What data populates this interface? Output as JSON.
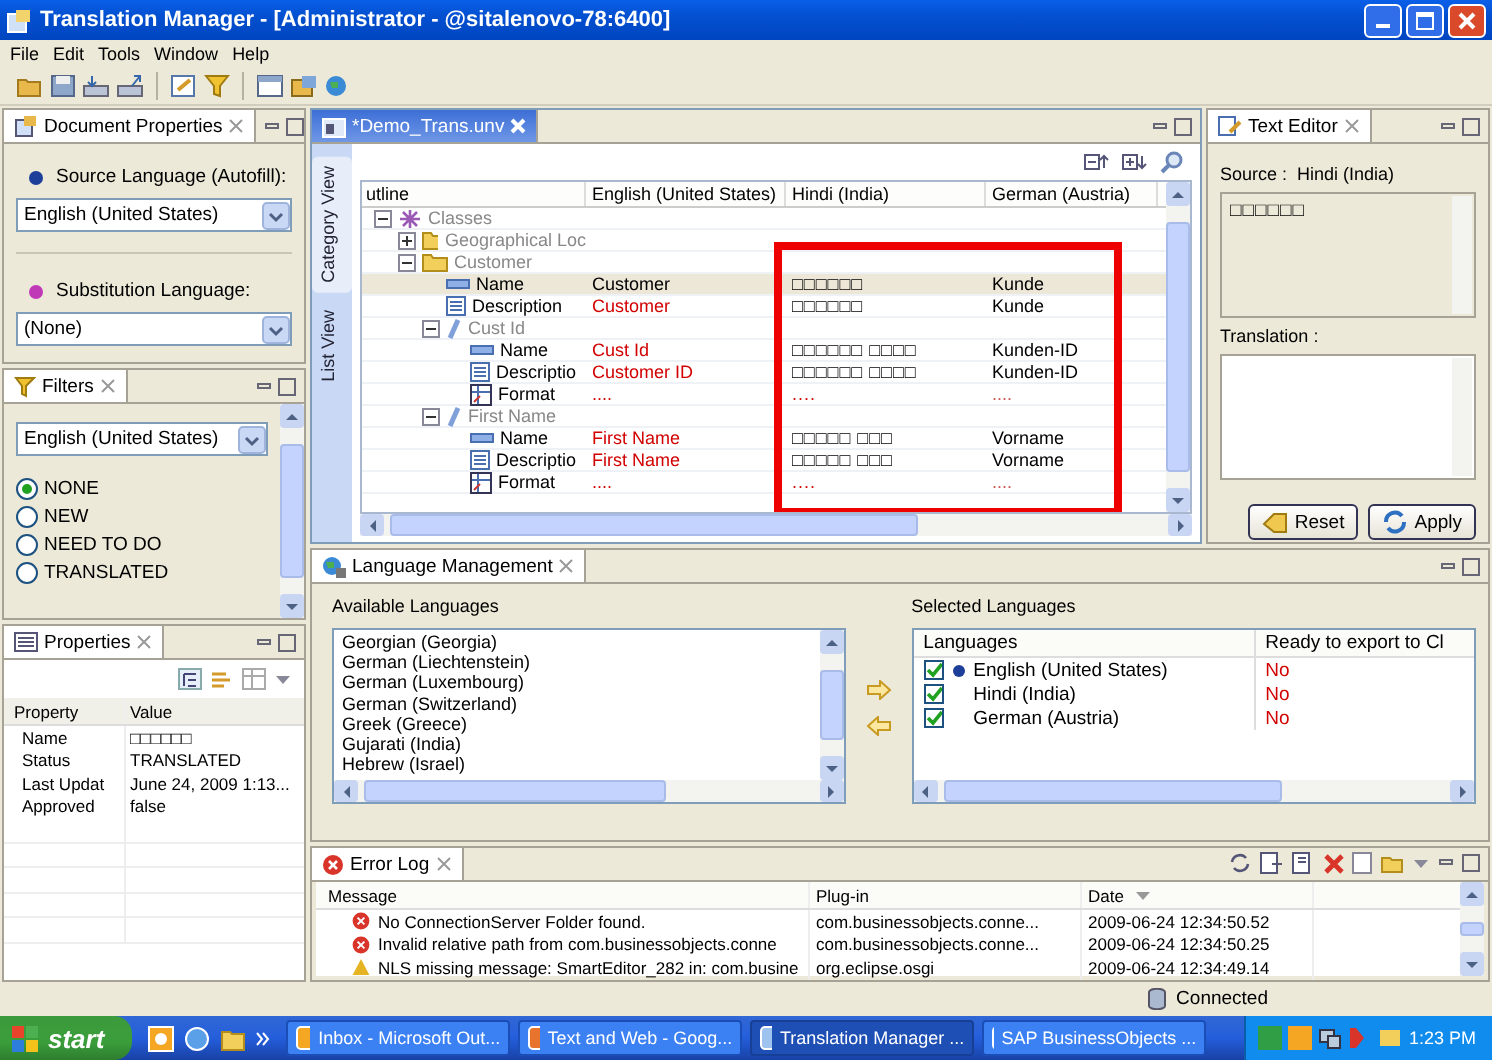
{
  "window": {
    "title": "Translation Manager - [Administrator - @sitalenovo-78:6400]"
  },
  "menu": [
    "File",
    "Edit",
    "Tools",
    "Window",
    "Help"
  ],
  "document_properties": {
    "tab": "Document Properties",
    "source_label": "Source Language (Autofill):",
    "source_value": "English (United States)",
    "substitution_label": "Substitution Language:",
    "substitution_value": "(None)"
  },
  "filters": {
    "tab": "Filters",
    "language": "English (United States)",
    "options": [
      {
        "label": "NONE",
        "selected": true
      },
      {
        "label": "NEW",
        "selected": false
      },
      {
        "label": "NEED TO DO",
        "selected": false
      },
      {
        "label": "TRANSLATED",
        "selected": false
      }
    ]
  },
  "properties": {
    "tab": "Properties",
    "columns": [
      "Property",
      "Value"
    ],
    "rows": [
      [
        "Name",
        "□□□□□□"
      ],
      [
        "Status",
        "TRANSLATED"
      ],
      [
        "Last Updat",
        "June 24, 2009 1:13..."
      ],
      [
        "Approved",
        "false"
      ]
    ]
  },
  "editor": {
    "tab": "*Demo_Trans.unv",
    "side_tabs": [
      {
        "label": "Category View",
        "selected": true
      },
      {
        "label": "List View",
        "selected": false
      }
    ],
    "columns": [
      "utline",
      "English (United States)",
      "Hindi (India)",
      "German (Austria)"
    ],
    "rows": [
      {
        "kind": "classes",
        "label": "Classes",
        "expanded": true,
        "selected": false,
        "children": [
          {
            "kind": "folder",
            "label": "Geographical Loc",
            "expanded": false,
            "selected": false
          },
          {
            "kind": "folder",
            "label": "Customer",
            "expanded": true,
            "selected": false,
            "children": [
              {
                "kind": "name",
                "label": "Name",
                "selected": true,
                "english": "Customer",
                "hindi": "□□□□□□",
                "german": "Kunde",
                "flagged": false
              },
              {
                "kind": "description",
                "label": "Description",
                "selected": false,
                "english": "Customer",
                "hindi": "□□□□□□",
                "german": "Kunde",
                "flagged": true
              },
              {
                "kind": "object",
                "label": "Cust Id",
                "expanded": true,
                "selected": false,
                "children": [
                  {
                    "kind": "name",
                    "label": "Name",
                    "selected": false,
                    "english": "Cust Id",
                    "hindi": "□□□□□□ □□□□",
                    "german": "Kunden-ID",
                    "flagged": true
                  },
                  {
                    "kind": "description",
                    "label": "Descriptio",
                    "selected": false,
                    "english": "Customer ID",
                    "hindi": "□□□□□□ □□□□",
                    "german": "Kunden-ID",
                    "flagged": true
                  },
                  {
                    "kind": "format",
                    "label": "Format",
                    "selected": false,
                    "english": "....",
                    "hindi": "....",
                    "german": "....",
                    "flagged": true
                  }
                ]
              },
              {
                "kind": "object",
                "label": "First Name",
                "expanded": true,
                "selected": false,
                "children": [
                  {
                    "kind": "name",
                    "label": "Name",
                    "selected": false,
                    "english": "First Name",
                    "hindi": "□□□□□ □□□",
                    "german": "Vorname",
                    "flagged": true
                  },
                  {
                    "kind": "description",
                    "label": "Descriptio",
                    "selected": false,
                    "english": "First Name",
                    "hindi": "□□□□□ □□□",
                    "german": "Vorname",
                    "flagged": true
                  },
                  {
                    "kind": "format",
                    "label": "Format",
                    "selected": false,
                    "english": "....",
                    "hindi": "....",
                    "german": "....",
                    "flagged": true
                  }
                ]
              }
            ]
          }
        ]
      }
    ]
  },
  "text_editor": {
    "tab": "Text Editor",
    "source_label": "Source :  Hindi (India)",
    "source_text": "□□□□□□",
    "translation_label": "Translation :",
    "buttons": [
      "Reset",
      "Apply"
    ]
  },
  "language_management": {
    "tab": "Language Management",
    "available_label": "Available Languages",
    "available": [
      "Georgian (Georgia)",
      "German (Liechtenstein)",
      "German (Luxembourg)",
      "German (Switzerland)",
      "Greek (Greece)",
      "Gujarati (India)",
      "Hebrew (Israel)"
    ],
    "selected_label": "Selected Languages",
    "columns": [
      "Languages",
      "Ready to export to Cl"
    ],
    "selected": [
      {
        "name": "English (United States)",
        "checked": true,
        "source": true,
        "ready": "No"
      },
      {
        "name": "Hindi (India)",
        "checked": true,
        "source": false,
        "ready": "No"
      },
      {
        "name": "German (Austria)",
        "checked": true,
        "source": false,
        "ready": "No"
      }
    ]
  },
  "error_log": {
    "tab": "Error Log",
    "columns": [
      "Message",
      "Plug-in",
      "Date"
    ],
    "rows": [
      {
        "kind": "error",
        "message": "No ConnectionServer Folder found.",
        "plugin": "com.businessobjects.conne...",
        "date": "2009-06-24 12:34:50.52"
      },
      {
        "kind": "error",
        "message": "Invalid relative path from com.businessobjects.conne",
        "plugin": "com.businessobjects.conne...",
        "date": "2009-06-24 12:34:50.25"
      },
      {
        "kind": "warning",
        "message": "NLS missing message: SmartEditor_282 in: com.busine",
        "plugin": "org.eclipse.osgi",
        "date": "2009-06-24 12:34:49.14"
      }
    ]
  },
  "status_bar": {
    "text": "Connected"
  },
  "taskbar": {
    "start": "start",
    "tasks": [
      {
        "label": "Inbox - Microsoft Out...",
        "selected": false
      },
      {
        "label": "Text and Web - Goog...",
        "selected": false
      },
      {
        "label": "Translation Manager ...",
        "selected": true
      },
      {
        "label": "SAP BusinessObjects ...",
        "selected": false
      }
    ],
    "clock": "1:23 PM"
  }
}
